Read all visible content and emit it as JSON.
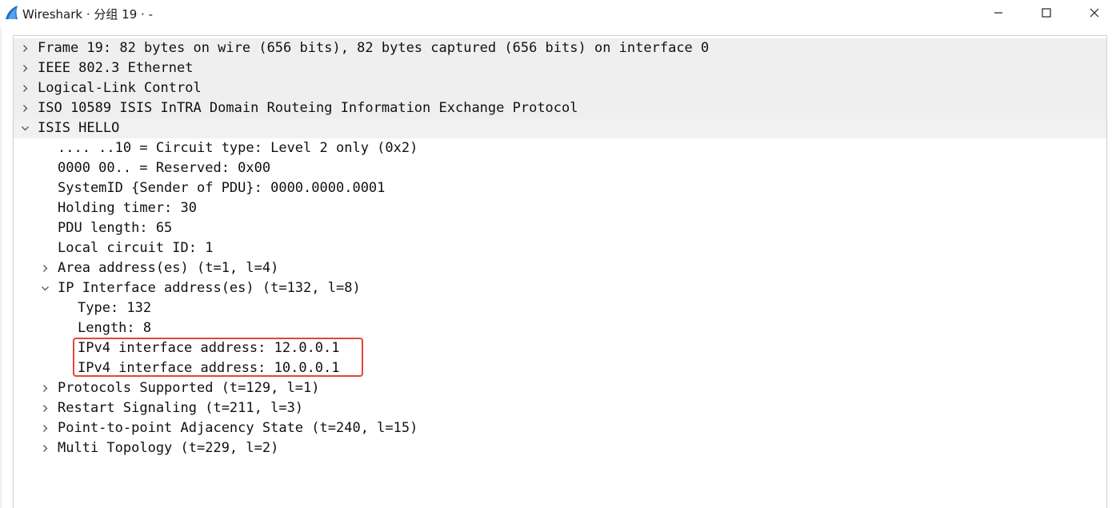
{
  "window": {
    "title": "Wireshark · 分组 19 · -",
    "app_icon": "wireshark-fin-icon",
    "controls": {
      "minimize_icon": "minimize-icon",
      "maximize_icon": "maximize-icon",
      "close_icon": "close-icon"
    }
  },
  "tree": {
    "frame": "Frame 19: 82 bytes on wire (656 bits), 82 bytes captured (656 bits) on interface 0",
    "ethernet": "IEEE 802.3 Ethernet",
    "llc": "Logical-Link Control",
    "isis": "ISO 10589 ISIS InTRA Domain Routeing Information Exchange Protocol",
    "hello": {
      "label": "ISIS HELLO",
      "circuit_type": ".... ..10 = Circuit type: Level 2 only (0x2)",
      "reserved": "0000 00.. = Reserved: 0x00",
      "system_id": "SystemID {Sender of PDU}: 0000.0000.0001",
      "holding_timer": "Holding timer: 30",
      "pdu_length": "PDU length: 65",
      "local_circuit_id": "Local circuit ID: 1",
      "area_addresses": "Area address(es) (t=1, l=4)",
      "ip_interface": {
        "label": "IP Interface address(es) (t=132, l=8)",
        "type": "Type: 132",
        "length": "Length: 8",
        "addresses": [
          "IPv4 interface address: 12.0.0.1",
          "IPv4 interface address: 10.0.0.1"
        ]
      },
      "protocols_supported": "Protocols Supported (t=129, l=1)",
      "restart_signaling": "Restart Signaling (t=211, l=3)",
      "p2p_adjacency": "Point-to-point Adjacency State (t=240, l=15)",
      "multi_topology": "Multi Topology (t=229, l=2)"
    }
  },
  "colors": {
    "highlight_border": "#e0473d",
    "toplevel_row_bg": "#efefef",
    "icon_blue": "#1e6fc8"
  }
}
